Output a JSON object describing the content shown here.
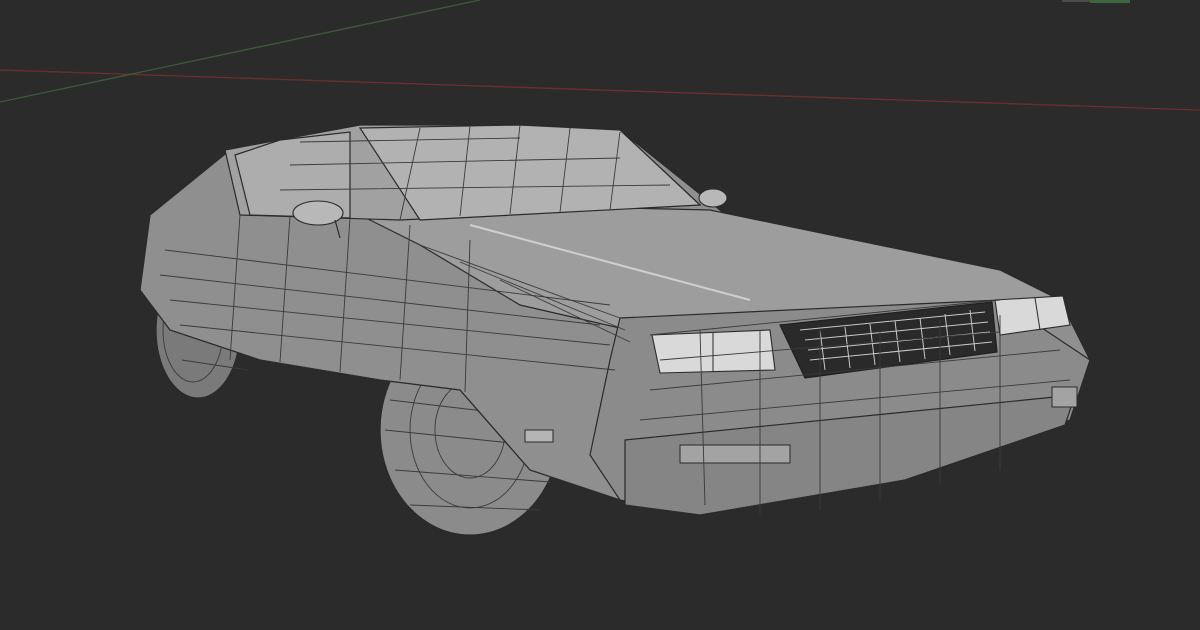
{
  "viewport": {
    "background_color": "#2b2b2b",
    "axis_x_color": "#6e2f2f",
    "axis_y_color": "#3f5a3b",
    "mesh_base_color": "#8d8d8d",
    "mesh_highlight_color": "#a7a7a7",
    "mesh_shadow_color": "#5f5f5f",
    "wire_color": "#3a3a3a",
    "headlight_color": "#d9d9d9",
    "grille_color": "#1f1f1f"
  }
}
